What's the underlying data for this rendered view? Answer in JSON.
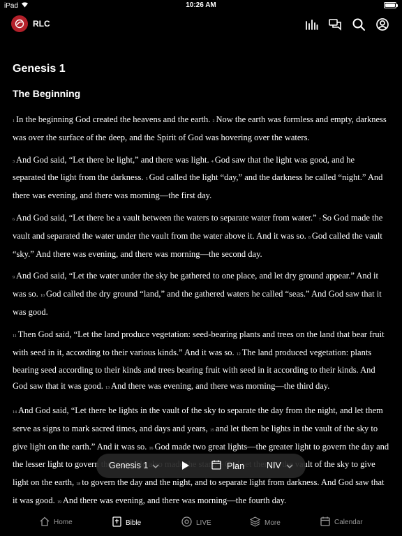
{
  "status_bar": {
    "device": "iPad",
    "time": "10:26 AM"
  },
  "app": {
    "name": "RLC"
  },
  "header_icons": [
    "audio-bars-icon",
    "chat-bubbles-icon",
    "search-icon",
    "account-icon"
  ],
  "reading": {
    "chapter_title": "Genesis 1",
    "section_title": "The Beginning",
    "paragraphs": [
      [
        {
          "n": "1",
          "t": "In the beginning God created the heavens and the earth."
        },
        {
          "n": "2",
          "t": "Now the earth was formless and empty, darkness was over the surface of the deep, and the Spirit of God was hovering over the waters."
        }
      ],
      [
        {
          "n": "3",
          "t": "And God said, “Let there be light,” and there was light."
        },
        {
          "n": "4",
          "t": "God saw that the light was good, and he separated the light from the darkness."
        },
        {
          "n": "5",
          "t": "God called the light “day,” and the darkness he called “night.” And there was evening, and there was morning—the first day."
        }
      ],
      [
        {
          "n": "6",
          "t": "And God said, “Let there be a vault between the waters to separate water from water.”"
        },
        {
          "n": "7",
          "t": "So God made the vault and separated the water under the vault from the water above it. And it was so."
        },
        {
          "n": "8",
          "t": "God called the vault “sky.” And there was evening, and there was morning—the second day."
        }
      ],
      [
        {
          "n": "9",
          "t": "And God said, “Let the water under the sky be gathered to one place, and let dry ground appear.” And it was so."
        },
        {
          "n": "10",
          "t": "God called the dry ground “land,” and the gathered waters he called “seas.” And God saw that it was good."
        }
      ],
      [
        {
          "n": "11",
          "t": "Then God said, “Let the land produce vegetation: seed-bearing plants and trees on the land that bear fruit with seed in it, according to their various kinds.” And it was so."
        },
        {
          "n": "12",
          "t": "The land produced vegetation: plants bearing seed according to their kinds and trees bearing fruit with seed in it according to their kinds. And God saw that it was good."
        },
        {
          "n": "13",
          "t": "And there was evening, and there was morning—the third day."
        }
      ],
      [
        {
          "n": "14",
          "t": "And God said, “Let there be lights in the vault of the sky to separate the day from the night, and let them serve as signs to mark sacred times, and days and years,"
        },
        {
          "n": "15",
          "t": "and let them be lights in the vault of the sky to give light on the earth.” And it was so."
        },
        {
          "n": "16",
          "t": "God made two great lights—the greater light to govern the day and the lesser light to govern the night. He also made the stars."
        },
        {
          "n": "17",
          "t": "God set them in the vault of the sky to give light on the earth,"
        },
        {
          "n": "18",
          "t": "to govern the day and the night, and to separate light from darkness. And God saw that it was good."
        },
        {
          "n": "19",
          "t": "And there was evening, and there was morning—the fourth day."
        }
      ]
    ]
  },
  "player": {
    "book_label": "Genesis 1",
    "plan_label": "Plan",
    "version_label": "NIV"
  },
  "tabs": [
    {
      "label": "Home",
      "icon": "home-icon",
      "active": false
    },
    {
      "label": "Bible",
      "icon": "bible-icon",
      "active": true
    },
    {
      "label": "LIVE",
      "icon": "live-icon",
      "active": false
    },
    {
      "label": "More",
      "icon": "stack-icon",
      "active": false
    },
    {
      "label": "Calendar",
      "icon": "calendar-icon",
      "active": false
    }
  ],
  "colors": {
    "background": "#000000",
    "logo": "#b3202a",
    "player": "#262626",
    "tab_inactive": "#9a9a9a"
  }
}
